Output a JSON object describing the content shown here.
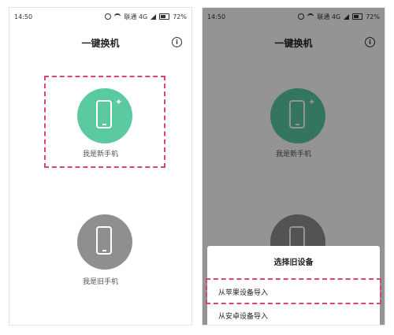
{
  "status": {
    "time": "14:50",
    "carrier": "联通 4G",
    "battery": "72%"
  },
  "header": {
    "title": "一键换机"
  },
  "options": {
    "new_phone": {
      "label": "我是新手机",
      "color": "#5bcaa0"
    },
    "old_phone": {
      "label": "我是旧手机",
      "color": "#8f8f8f"
    }
  },
  "sheet": {
    "title": "选择旧设备",
    "items": [
      {
        "label": "从苹果设备导入"
      },
      {
        "label": "从安卓设备导入"
      }
    ]
  },
  "icons": [
    "alarm-icon",
    "wifi-icon",
    "signal-icon",
    "battery-icon",
    "info-icon",
    "phone-icon",
    "sparkle-icon"
  ],
  "colors": {
    "highlight": "#d6476a",
    "overlay": "rgba(0,0,0,0.42)"
  }
}
